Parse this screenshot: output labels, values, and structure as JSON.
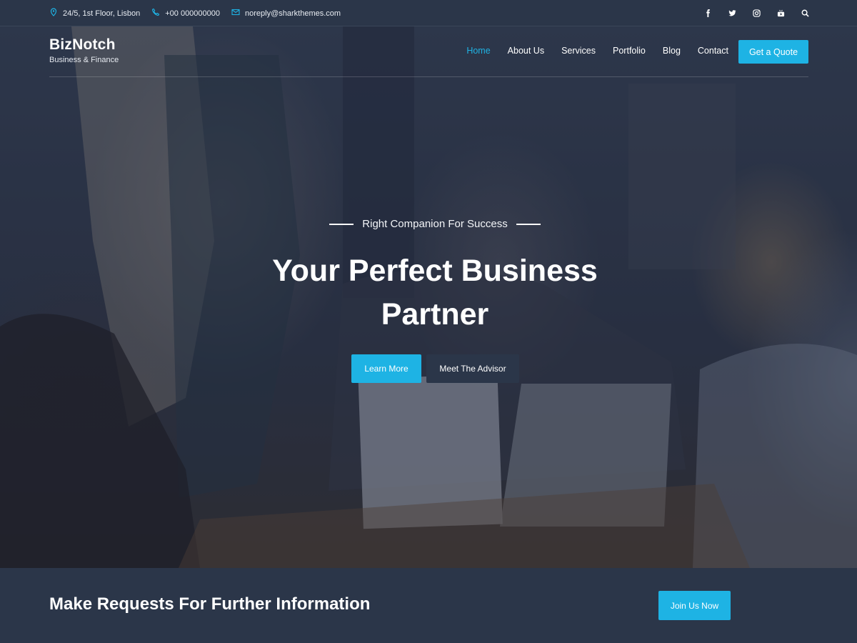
{
  "topbar": {
    "address": "24/5, 1st Floor, Lisbon",
    "phone": "+00 000000000",
    "email": "noreply@sharkthemes.com",
    "social_icons": [
      "facebook-icon",
      "twitter-icon",
      "instagram-icon",
      "youtube-icon",
      "search-icon"
    ]
  },
  "brand": {
    "name": "BizNotch",
    "tagline": "Business & Finance"
  },
  "nav": {
    "items": [
      "Home",
      "About Us",
      "Services",
      "Portfolio",
      "Blog",
      "Contact"
    ],
    "active": "Home",
    "quote_label": "Get a Quote"
  },
  "hero": {
    "eyebrow": "Right Companion For Success",
    "headline_line1": "Your Perfect Business",
    "headline_line2": "Partner",
    "learn_more": "Learn More",
    "meet_advisor": "Meet The Advisor"
  },
  "cta_strip": {
    "title": "Make Requests For Further Information",
    "join_label": "Join Us Now"
  },
  "colors": {
    "accent": "#1eb3e4",
    "dark": "#2b3649"
  }
}
